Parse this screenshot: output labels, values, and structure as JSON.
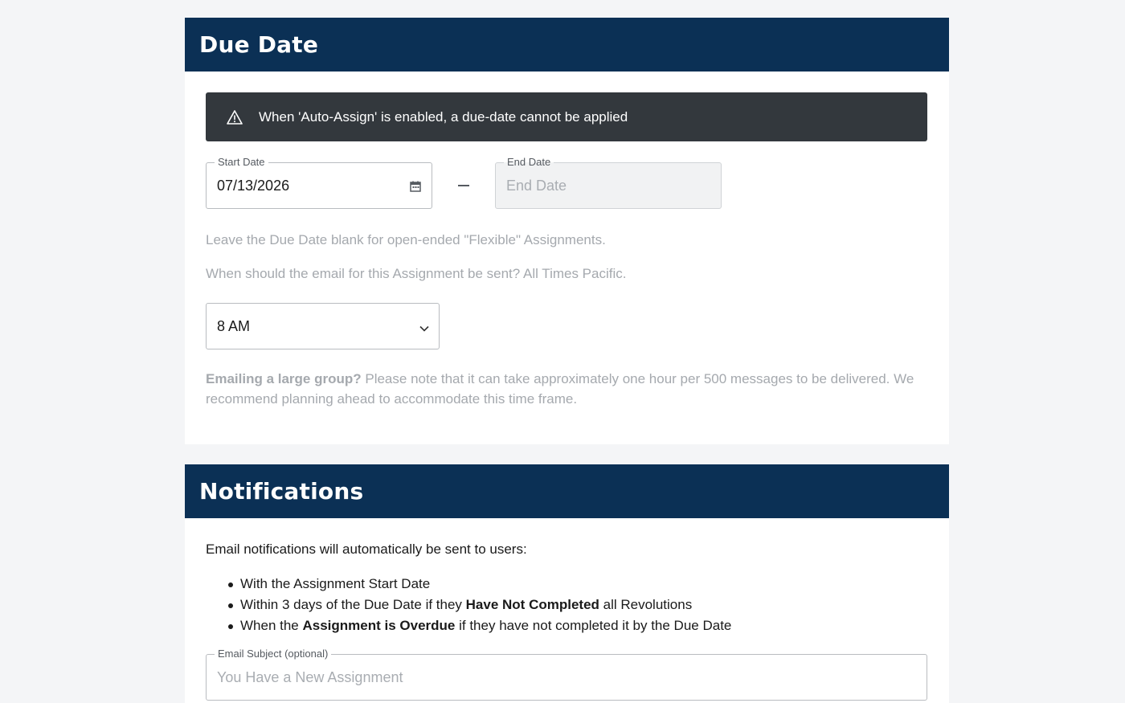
{
  "due_date": {
    "title": "Due Date",
    "alert_text": "When 'Auto-Assign' is enabled, a due-date cannot be applied",
    "start_date": {
      "label": "Start Date",
      "value": "07/13/2026"
    },
    "end_date": {
      "label": "End Date",
      "placeholder": "End Date"
    },
    "hint_flexible": "Leave the Due Date blank for open-ended \"Flexible\" Assignments.",
    "hint_email_time": "When should the email for this Assignment be sent? All Times Pacific.",
    "send_time": {
      "selected": "8 AM"
    },
    "large_group": {
      "bold": "Emailing a large group?",
      "text": " Please note that it can take approximately one hour per 500 messages to be delivered. We recommend planning ahead to accommodate this time frame."
    }
  },
  "notifications": {
    "title": "Notifications",
    "intro": "Email notifications will automatically be sent to users:",
    "items": [
      {
        "pre": "With the Assignment Start Date",
        "bold": "",
        "post": ""
      },
      {
        "pre": "Within 3 days of the Due Date if they ",
        "bold": "Have Not Completed",
        "post": " all Revolutions"
      },
      {
        "pre": "When the ",
        "bold": "Assignment is Overdue",
        "post": " if they have not completed it by the Due Date"
      }
    ],
    "subject": {
      "label": "Email Subject (optional)",
      "placeholder": "You Have a New Assignment"
    }
  },
  "colors": {
    "header_bg": "#0b3055",
    "alert_bg": "#33383d",
    "page_bg": "#f4f5f7"
  },
  "icons": [
    "warning-icon",
    "calendar-icon",
    "chevron-down-icon"
  ]
}
